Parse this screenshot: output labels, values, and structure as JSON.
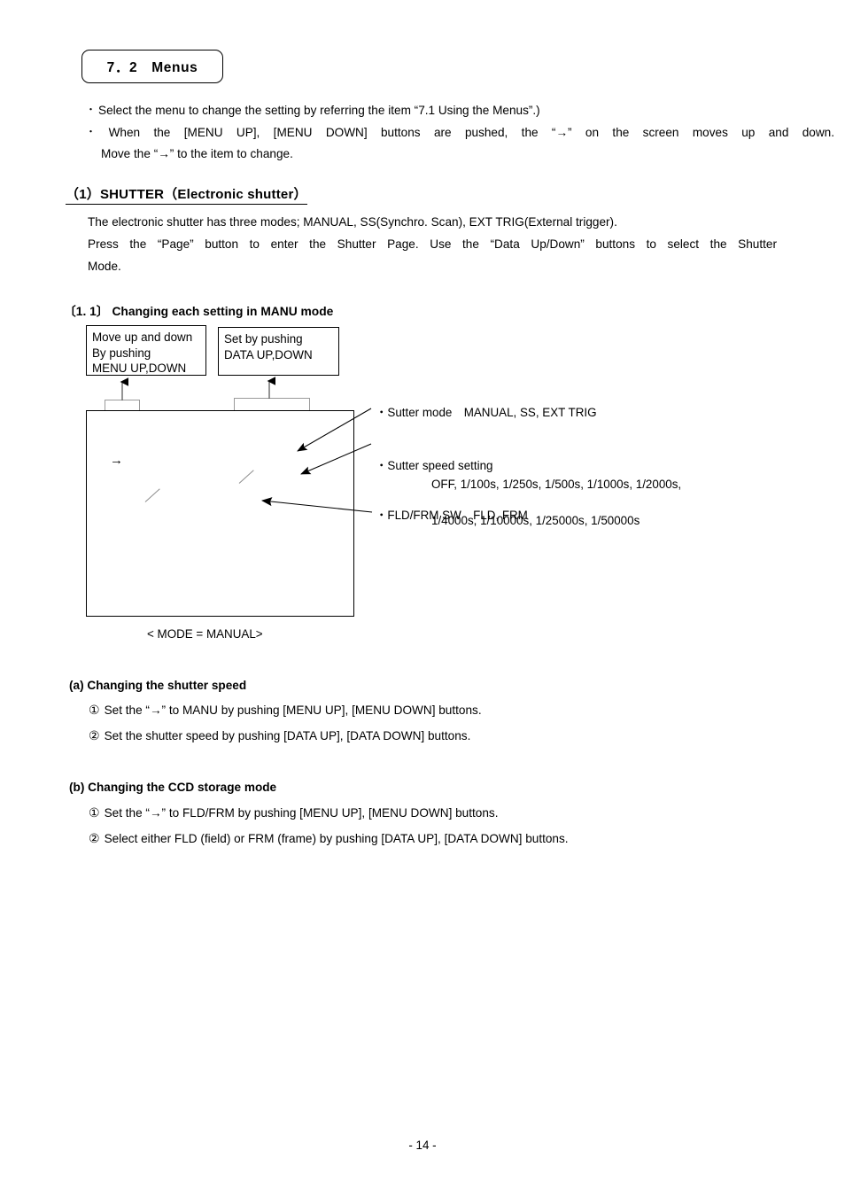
{
  "section": {
    "heading": "7．2　Menus"
  },
  "intro": {
    "bullet_glyph": "・",
    "line1": "Select the menu to change the setting by referring the item “7.1 Using the Menus”.)",
    "line2": "When the [MENU UP], [MENU DOWN] buttons are pushed, the “→” on the screen moves up and down.",
    "line3": "Move the “→” to the item to change."
  },
  "shutter": {
    "heading": "（1）SHUTTER（Electronic shutter）",
    "line1": "The electronic shutter has three modes; MANUAL, SS(Synchro. Scan), EXT TRIG(External trigger).",
    "line2": "Press the “Page” button to enter the Shutter Page. Use the “Data Up/Down” buttons to select the Shutter",
    "line3": "Mode."
  },
  "subsection": {
    "heading": "〔1. 1〕 Changing each setting in MANU mode"
  },
  "diagram": {
    "callout_menu": "Move up and down\nBy pushing\nMENU UP,DOWN",
    "callout_data": "Set by pushing\nDATA UP,DOWN",
    "screen_cursor": "→",
    "caption": "< MODE = MANUAL>",
    "annotations": {
      "shutter_mode_label": "・Sutter mode MANUAL, SS, EXT TRIG",
      "shutter_speed_label": "・Sutter speed setting",
      "shutter_speed_values_line1": "OFF, 1/100s, 1/250s, 1/500s, 1/1000s, 1/2000s,",
      "shutter_speed_values_line2": "1/4000s, 1/10000s, 1/25000s, 1/50000s",
      "fld_frm_label": "・FLD/FRM SW FLD, FRM"
    }
  },
  "block_a": {
    "heading": "(a) Changing the shutter speed",
    "item1_num": "①",
    "item1": "Set the “→” to MANU by pushing [MENU UP], [MENU DOWN] buttons.",
    "item2_num": "②",
    "item2": "Set the shutter speed by pushing [DATA UP], [DATA DOWN] buttons."
  },
  "block_b": {
    "heading": "(b) Changing the CCD storage mode",
    "item1_num": "①",
    "item1": "Set the “→” to FLD/FRM by pushing [MENU UP], [MENU DOWN] buttons.",
    "item2_num": "②",
    "item2": "Select either FLD (field) or FRM (frame) by pushing [DATA UP], [DATA DOWN] buttons."
  },
  "footer": {
    "page_number": "- 14 -"
  },
  "colors": {
    "ink": "#000000",
    "paper": "#ffffff",
    "stub_border": "#9a9a9a",
    "ghost_stroke": "#8d8d8d"
  }
}
